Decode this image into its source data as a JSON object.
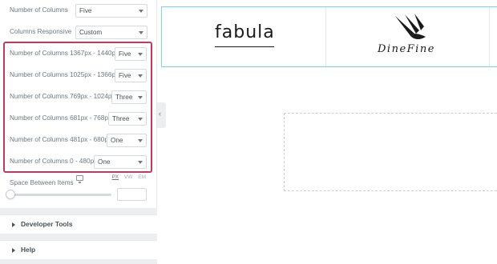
{
  "panel": {
    "number_of_columns": {
      "label": "Number of Columns",
      "value": "Five"
    },
    "columns_responsive": {
      "label": "Columns Responsive",
      "value": "Custom"
    },
    "responsive_rows": [
      {
        "label": "Number of Columns 1367px - 1440px",
        "value": "Five"
      },
      {
        "label": "Number of Columns 1025px - 1366px",
        "value": "Five"
      },
      {
        "label": "Number of Columns 769px - 1024px",
        "value": "Three"
      },
      {
        "label": "Number of Columns 681px - 768px",
        "value": "Three"
      },
      {
        "label": "Number of Columns 481px - 680px",
        "value": "One"
      },
      {
        "label": "Number of Columns 0 - 480px",
        "value": "One"
      }
    ],
    "space_between": {
      "label": "Space Between Items",
      "units": [
        "PX",
        "VW",
        "EM"
      ],
      "value": ""
    },
    "sections": [
      {
        "title": "Developer Tools"
      },
      {
        "title": "Help"
      }
    ],
    "highlight_color": "#c3395a"
  },
  "canvas": {
    "logos": [
      {
        "name": "fabula",
        "text": "fabula"
      },
      {
        "name": "dinefine",
        "text": "DineFine"
      }
    ],
    "border_color": "#71d7f7"
  }
}
